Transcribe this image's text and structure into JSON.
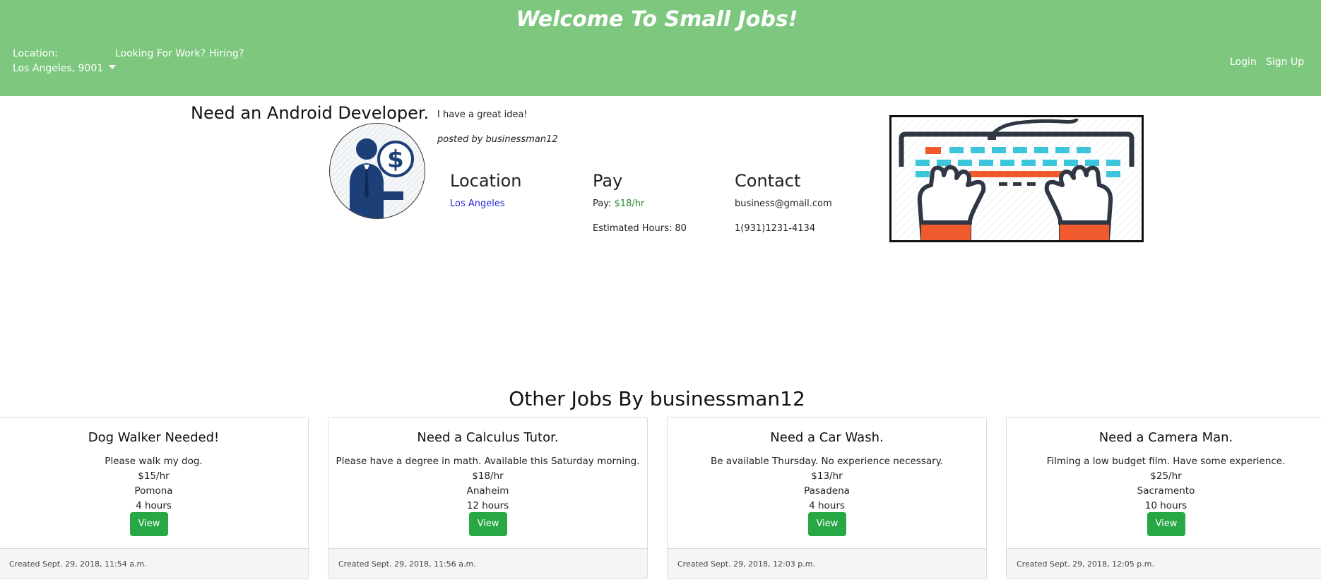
{
  "colors": {
    "brand": "#7dc87e",
    "green": "#2a8a2a",
    "link": "#2626d6",
    "button": "#28a745"
  },
  "header": {
    "title": "Welcome To Small Jobs!",
    "location_label": "Location:",
    "location_value": "Los Angeles, 9001",
    "nav": {
      "looking": "Looking For Work?",
      "hiring": "Hiring?",
      "login": "Login",
      "signup": "Sign Up"
    }
  },
  "job": {
    "title": "Need an Android Developer.",
    "description": "I have a great idea!",
    "posted_by": "posted by businessman12",
    "avatar_icon": "businessman-dollar-icon",
    "image_icon": "keyboard-hands-illustration",
    "location": {
      "heading": "Location",
      "value": "Los Angeles"
    },
    "pay": {
      "heading": "Pay",
      "label": "Pay:",
      "rate": "$18/hr",
      "hours": "Estimated Hours: 80"
    },
    "contact": {
      "heading": "Contact",
      "email": "business@gmail.com",
      "phone": "1(931)1231-4134"
    }
  },
  "other_jobs": {
    "heading": "Other Jobs By businessman12",
    "cards": [
      {
        "title": "Dog Walker Needed!",
        "description": "Please walk my dog.",
        "pay": "$15/hr",
        "location": "Pomona",
        "hours": "4 hours",
        "button": "View",
        "created": "Created Sept. 29, 2018, 11:54 a.m."
      },
      {
        "title": "Need a Calculus Tutor.",
        "description": "Please have a degree in math. Available this Saturday morning.",
        "pay": "$18/hr",
        "location": "Anaheim",
        "hours": "12 hours",
        "button": "View",
        "created": "Created Sept. 29, 2018, 11:56 a.m."
      },
      {
        "title": "Need a Car Wash.",
        "description": "Be available Thursday. No experience necessary.",
        "pay": "$13/hr",
        "location": "Pasadena",
        "hours": "4 hours",
        "button": "View",
        "created": "Created Sept. 29, 2018, 12:03 p.m."
      },
      {
        "title": "Need a Camera Man.",
        "description": "Filming a low budget film. Have some experience.",
        "pay": "$25/hr",
        "location": "Sacramento",
        "hours": "10 hours",
        "button": "View",
        "created": "Created Sept. 29, 2018, 12:05 p.m."
      }
    ]
  }
}
